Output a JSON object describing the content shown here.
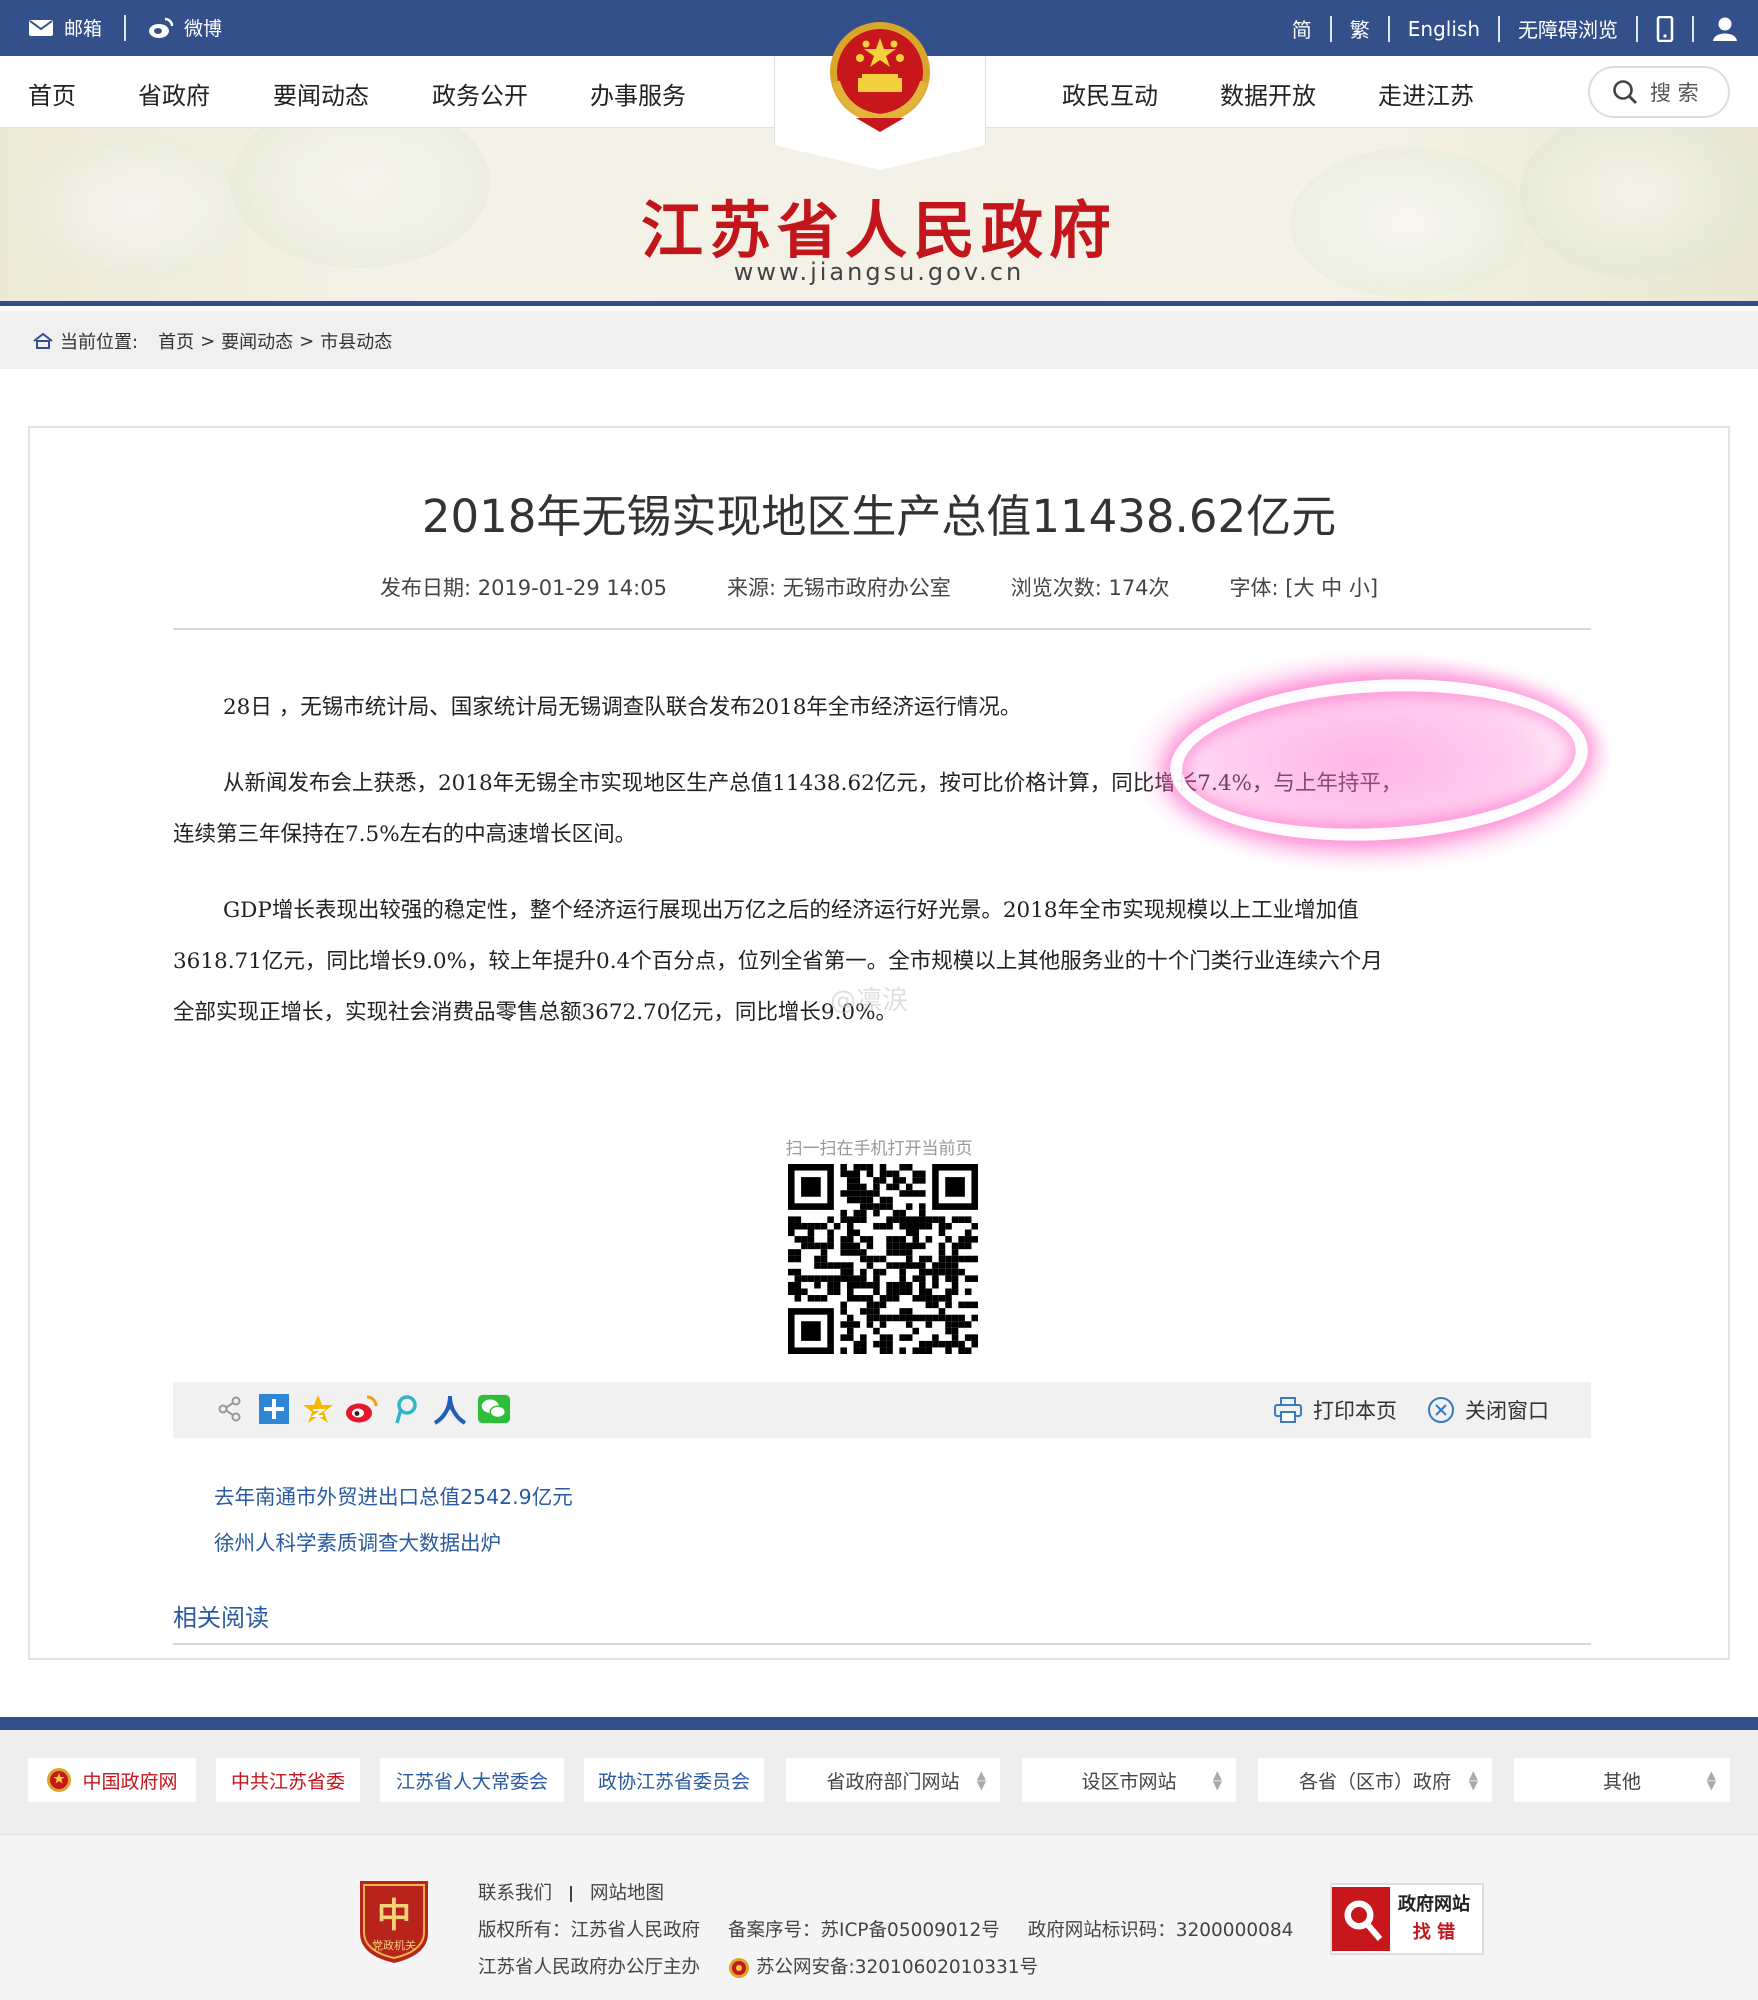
{
  "topbar": {
    "mail": "邮箱",
    "weibo": "微博",
    "simplified": "简",
    "traditional": "繁",
    "english": "English",
    "accessible": "无障碍浏览"
  },
  "nav": {
    "items": [
      "首页",
      "省政府",
      "要闻动态",
      "政务公开",
      "办事服务",
      "政民互动",
      "数据开放",
      "走进江苏"
    ],
    "search": "搜 索"
  },
  "banner": {
    "title": "江苏省人民政府",
    "url": "www.jiangsu.gov.cn"
  },
  "breadcrumb": {
    "label": "当前位置:",
    "items": [
      "首页",
      "要闻动态",
      "市县动态"
    ],
    "sep": ">"
  },
  "article": {
    "title": "2018年无锡实现地区生产总值11438.62亿元",
    "meta": {
      "date": "发布日期: 2019-01-29 14:05",
      "source": "来源: 无锡市政府办公室",
      "views": "浏览次数: 174次",
      "font": "字体: [大 中 小]"
    },
    "p1": "28日 ，无锡市统计局、国家统计局无锡调查队联合发布2018年全市经济运行情况。",
    "p2a": "从新闻发布会上获悉，2018年无锡全市实现地区生产总值11438.62亿元，按可比价格计算，同比增长7.4%，与上年持平，",
    "p2b": "连续第三年保持在7.5%左右的中高速增长区间。",
    "p3a": "GDP增长表现出较强的稳定性，整个经济运行展现出万亿之后的经济运行好光景。2018年全市实现规模以上工业增加值",
    "p3b": "3618.71亿元，同比增长9.0%，较上年提升0.4个百分点，位列全省第一。全市规模以上其他服务业的十个门类行业连续六个月",
    "p3c": "全部实现正增长，实现社会消费品零售总额3672.70亿元，同比增长9.0%。",
    "watermark": "@凛涙",
    "qr_label": "扫一扫在手机打开当前页",
    "print": "打印本页",
    "close": "关闭窗口",
    "links": [
      "去年南通市外贸进出口总值2542.9亿元",
      "徐州人科学素质调查大数据出炉"
    ],
    "related": "相关阅读"
  },
  "footer_links": {
    "gov": "中国政府网",
    "party": "中共江苏省委",
    "congress": "江苏省人大常委会",
    "cppcc": "政协江苏省委员会",
    "depts": "省政府部门网站",
    "cities": "设区市网站",
    "provinces": "各省（区市）政府",
    "other": "其他"
  },
  "footer": {
    "contact": "联系我们",
    "sitemap": "网站地图",
    "copyright": "版权所有：江苏省人民政府",
    "icp": "备案序号：苏ICP备05009012号",
    "site_id": "政府网站标识码：3200000084",
    "host": "江苏省人民政府办公厅主办",
    "police": "苏公网安备:32010602010331号",
    "logo_text": "党政机关",
    "badge_line1": "政府网站",
    "badge_line2": "找 错"
  },
  "colors": {
    "brand_blue": "#34508a",
    "brand_red": "#c3161c",
    "link_blue": "#2a5a9f"
  }
}
